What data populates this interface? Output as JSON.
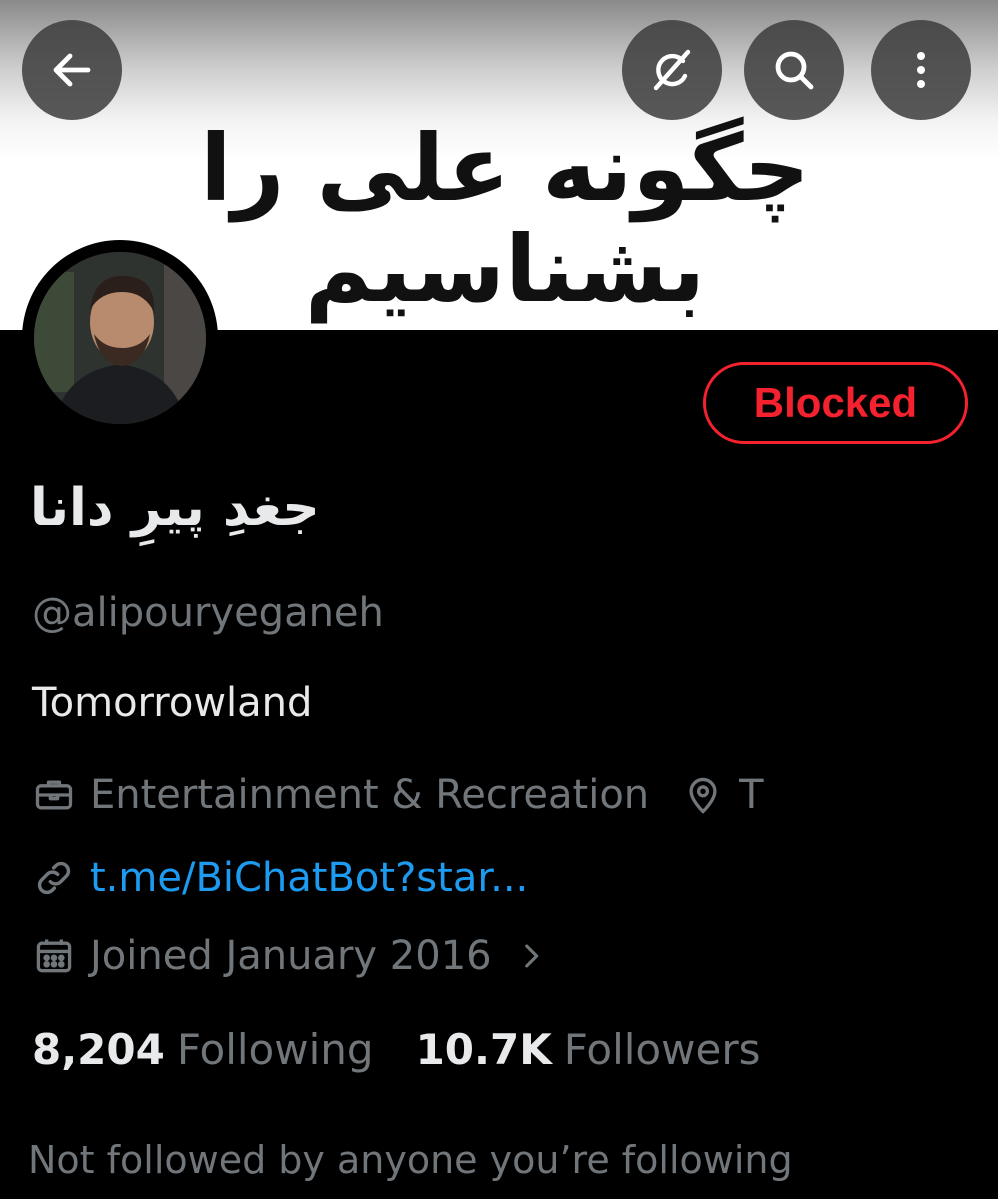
{
  "header": {
    "banner_text": "چگونه علی را بشناسیم",
    "back_icon": "arrow-left-icon",
    "grok_icon": "grok-icon",
    "search_icon": "search-icon",
    "more_icon": "more-vertical-icon"
  },
  "profile": {
    "display_name": "جغدِ پیرِ دانا",
    "handle": "@alipouryeganeh",
    "bio": "Tomorrowland",
    "category": "Entertainment & Recreation",
    "location": "T",
    "link": "t.me/BiChatBot?star...",
    "joined": "Joined January 2016",
    "following_count": "8,204",
    "following_label": "Following",
    "followers_count": "10.7K",
    "followers_label": "Followers",
    "mutuals_note": "Not followed by anyone you’re following"
  },
  "actions": {
    "blocked_label": "Blocked"
  },
  "colors": {
    "background": "#000000",
    "text_primary": "#e7e9ea",
    "text_secondary": "#71767b",
    "link": "#1d9bf0",
    "blocked": "#f4212e"
  }
}
